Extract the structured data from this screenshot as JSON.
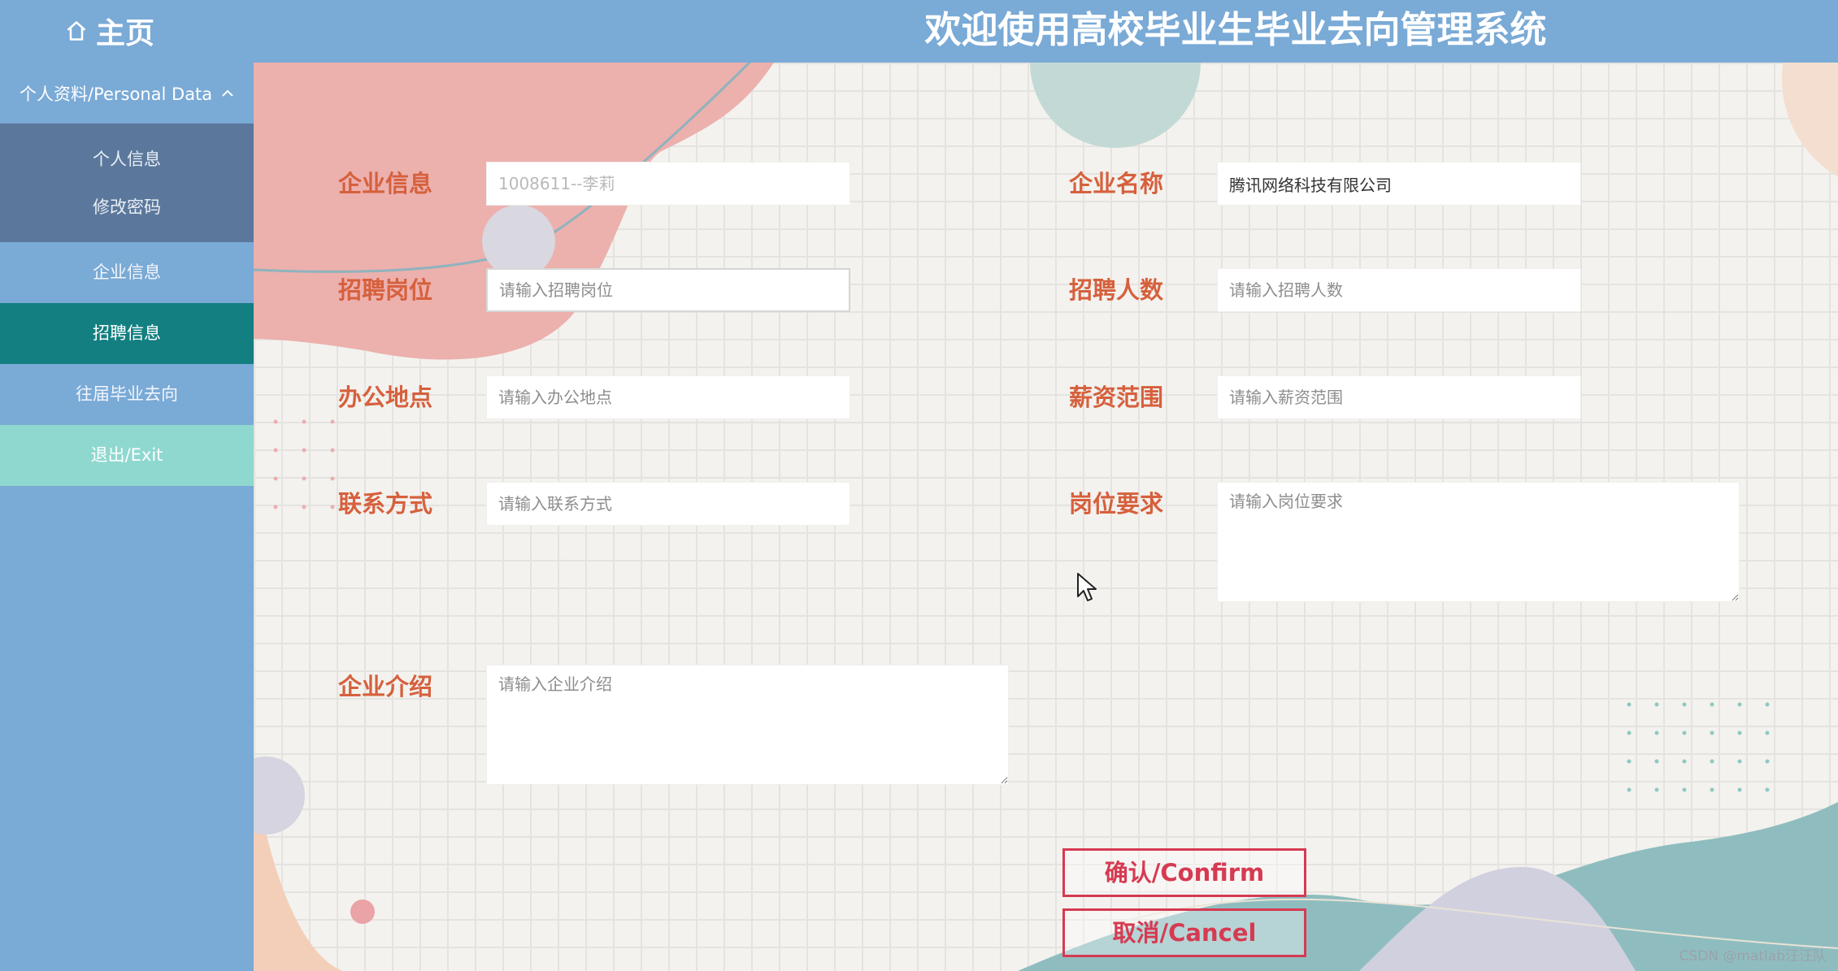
{
  "header": {
    "home_label": "主页",
    "title": "欢迎使用高校毕业生毕业去向管理系统"
  },
  "sidebar": {
    "group": {
      "label": "个人资料/Personal Data",
      "items": [
        "个人信息",
        "修改密码"
      ]
    },
    "items": [
      {
        "label": "企业信息",
        "active": false
      },
      {
        "label": "招聘信息",
        "active": true
      },
      {
        "label": "往届毕业去向",
        "active": false
      },
      {
        "label": "退出/Exit",
        "active": false
      }
    ]
  },
  "form": {
    "company_info": {
      "label": "企业信息",
      "placeholder": "1008611--李莉"
    },
    "company_name": {
      "label": "企业名称",
      "value": "腾讯网络科技有限公司"
    },
    "position": {
      "label": "招聘岗位",
      "placeholder": "请输入招聘岗位"
    },
    "headcount": {
      "label": "招聘人数",
      "placeholder": "请输入招聘人数"
    },
    "office": {
      "label": "办公地点",
      "placeholder": "请输入办公地点"
    },
    "salary": {
      "label": "薪资范围",
      "placeholder": "请输入薪资范围"
    },
    "contact": {
      "label": "联系方式",
      "placeholder": "请输入联系方式"
    },
    "requirements": {
      "label": "岗位要求",
      "placeholder": "请输入岗位要求"
    },
    "intro": {
      "label": "企业介绍",
      "placeholder": "请输入企业介绍"
    }
  },
  "buttons": {
    "confirm": "确认/Confirm",
    "cancel": "取消/Cancel"
  },
  "watermark": "CSDN @matlab汪汪队",
  "colors": {
    "header_bg": "#7aaad6",
    "submenu_bg": "#5b789c",
    "active_bg": "#137f81",
    "exit_bg": "#8fd8cf",
    "label": "#d6603d",
    "button": "#d63a52"
  },
  "icons": {
    "home": "home-icon",
    "group_toggle": "chevron-up-icon"
  }
}
